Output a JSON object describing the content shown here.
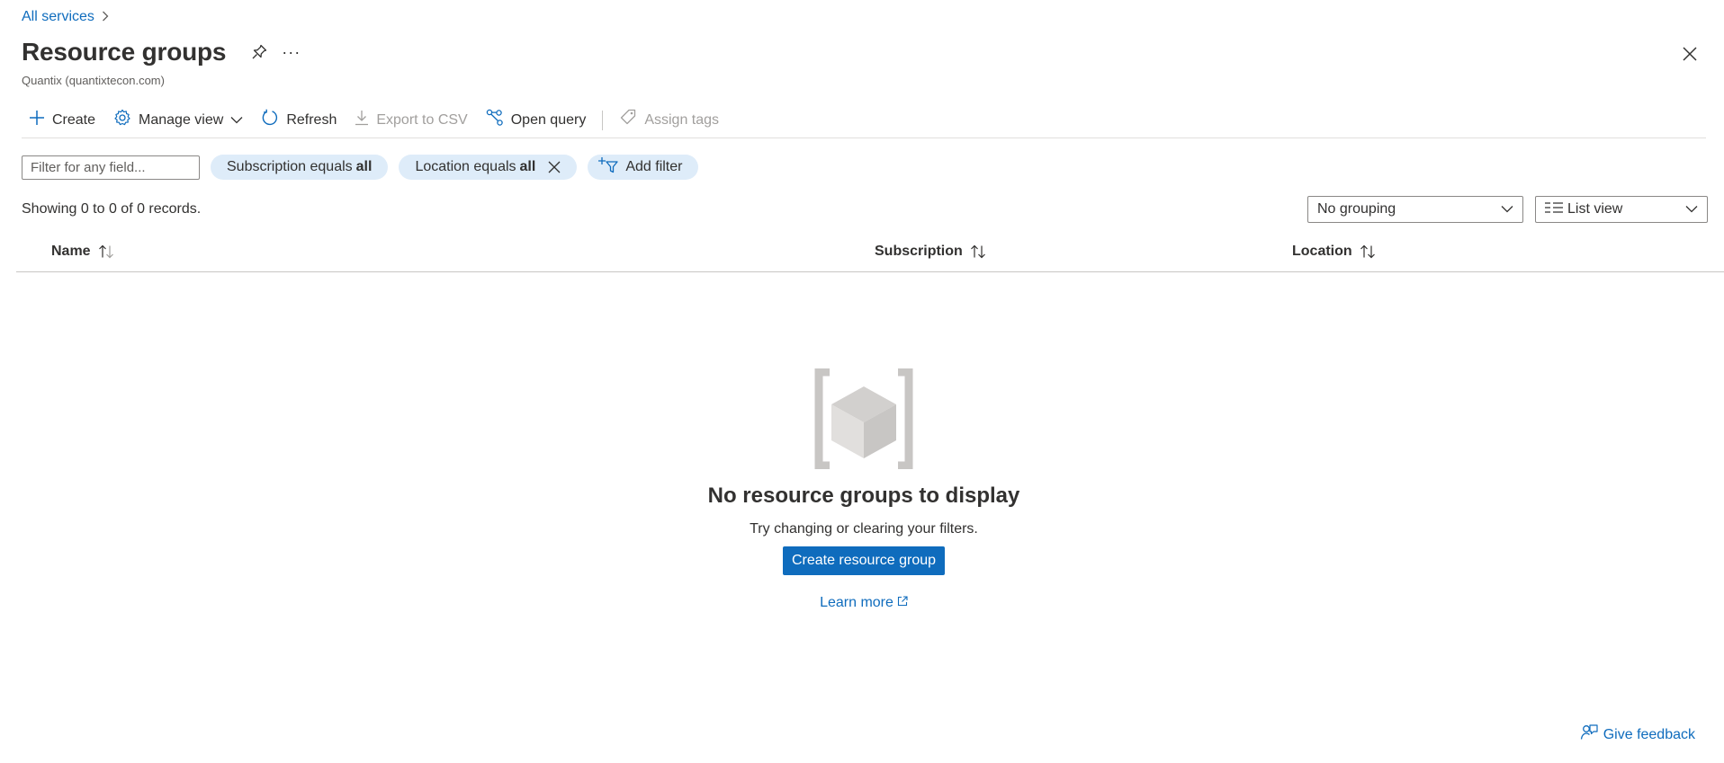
{
  "breadcrumb": {
    "link": "All services",
    "separator": ">"
  },
  "header": {
    "title": "Resource groups",
    "subtitle": "Quantix (quantixtecon.com)",
    "more_glyph": "···"
  },
  "toolbar": {
    "create": "Create",
    "manage_view": "Manage view",
    "refresh": "Refresh",
    "export_csv": "Export to CSV",
    "open_query": "Open query",
    "assign_tags": "Assign tags"
  },
  "filters": {
    "placeholder": "Filter for any field...",
    "subscription_prefix": "Subscription equals",
    "subscription_value": "all",
    "location_prefix": "Location equals",
    "location_value": "all",
    "add_filter": "Add filter"
  },
  "records_text": "Showing 0 to 0 of 0 records.",
  "grouping": {
    "selected": "No grouping"
  },
  "view": {
    "selected": "List view"
  },
  "table": {
    "columns": [
      {
        "label": "Name"
      },
      {
        "label": "Subscription"
      },
      {
        "label": "Location"
      }
    ],
    "rows": []
  },
  "empty_state": {
    "title": "No resource groups to display",
    "subtitle": "Try changing or clearing your filters.",
    "button": "Create resource group",
    "learn_more": "Learn more"
  },
  "feedback": "Give feedback",
  "colors": {
    "accent": "#0f6cbd",
    "pill_bg": "#deecf9",
    "text": "#323130",
    "disabled": "#a19f9d"
  }
}
